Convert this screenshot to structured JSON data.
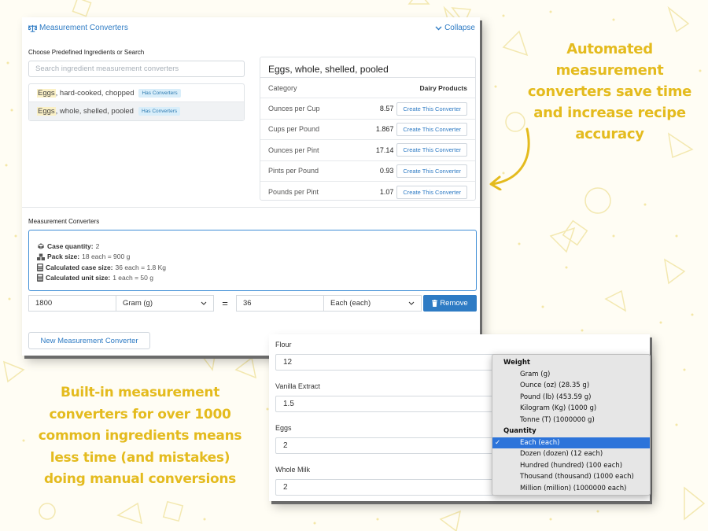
{
  "colors": {
    "accent_blue": "#2e7bc4",
    "callout_yellow": "#e4bb1e",
    "menu_selected": "#2d74da"
  },
  "main_panel": {
    "title": "Measurement Converters",
    "title_icon": "scale-icon",
    "collapse_label": "Collapse",
    "collapse_icon": "chevron-down-icon",
    "choose_label": "Choose Predefined Ingredients or Search",
    "search_placeholder": "Search ingredient measurement converters",
    "ingredients": [
      {
        "highlight": "Eggs",
        "rest": ", hard-cooked, chopped",
        "badge": "Has Converters"
      },
      {
        "highlight": "Eggs",
        "rest": ", whole, shelled, pooled",
        "badge": "Has Converters"
      }
    ],
    "detail": {
      "title": "Eggs, whole, shelled, pooled",
      "category_label": "Category",
      "category_value": "Dairy Products",
      "rows": [
        {
          "label": "Ounces per Cup",
          "value": "8.57",
          "button": "Create This Converter"
        },
        {
          "label": "Cups per Pound",
          "value": "1.867",
          "button": "Create This Converter"
        },
        {
          "label": "Ounces per Pint",
          "value": "17.14",
          "button": "Create This Converter"
        },
        {
          "label": "Pints per Pound",
          "value": "0.93",
          "button": "Create This Converter"
        },
        {
          "label": "Pounds per Pint",
          "value": "1.07",
          "button": "Create This Converter"
        }
      ]
    },
    "converters_label": "Measurement Converters",
    "info": [
      {
        "icon": "box-icon",
        "label": "Case quantity:",
        "value": "2"
      },
      {
        "icon": "boxes-icon",
        "label": "Pack size:",
        "value": "18 each = 900 g"
      },
      {
        "icon": "calculator-icon",
        "label": "Calculated case size:",
        "value": "36 each = 1.8 Kg"
      },
      {
        "icon": "calculator-icon",
        "label": "Calculated unit size:",
        "value": "1 each = 50 g"
      }
    ],
    "converter_row": {
      "left_value": "1800",
      "left_unit": "Gram (g)",
      "equals": "=",
      "right_value": "36",
      "right_unit": "Each (each)",
      "remove_label": "Remove"
    },
    "new_button": "New Measurement Converter"
  },
  "callouts": {
    "top": [
      "Automated",
      "measurement",
      "converters save time",
      "and increase recipe",
      "accuracy"
    ],
    "bottom": [
      "Built-in measurement",
      "converters for over 1000",
      "common ingredients means",
      "less time (and mistakes)",
      "doing manual conversions"
    ]
  },
  "ingredients_panel": {
    "rows": [
      {
        "label": "Flour",
        "value": "12"
      },
      {
        "label": "Vanilla Extract",
        "value": "1.5"
      },
      {
        "label": "Eggs",
        "value": "2"
      },
      {
        "label": "Whole Milk",
        "value": "2"
      }
    ]
  },
  "unit_menu": {
    "groups": [
      {
        "name": "Weight",
        "options": [
          "Gram (g)",
          "Ounce (oz) (28.35 g)",
          "Pound (lb) (453.59 g)",
          "Kilogram (Kg) (1000 g)",
          "Tonne (T) (1000000 g)"
        ]
      },
      {
        "name": "Quantity",
        "options": [
          "Each (each)",
          "Dozen (dozen) (12 each)",
          "Hundred (hundred) (100 each)",
          "Thousand (thousand) (1000 each)",
          "Million (million) (1000000 each)"
        ]
      }
    ],
    "selected": "Each (each)",
    "check_mark": "✓"
  }
}
